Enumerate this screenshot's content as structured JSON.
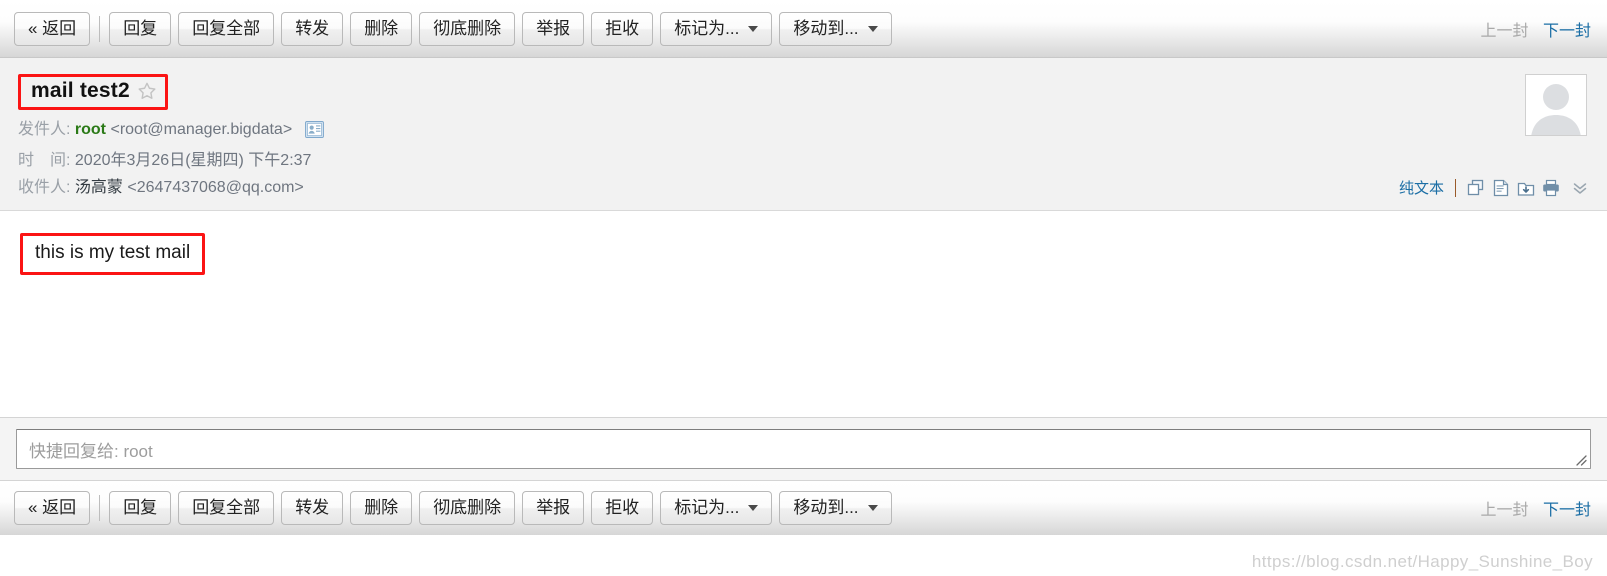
{
  "toolbar": {
    "buttons": [
      {
        "label": "« 返回",
        "type": "plain",
        "name": "back-button"
      },
      {
        "label": "回复",
        "type": "plain",
        "name": "reply-button"
      },
      {
        "label": "回复全部",
        "type": "plain",
        "name": "reply-all-button"
      },
      {
        "label": "转发",
        "type": "plain",
        "name": "forward-button"
      },
      {
        "label": "删除",
        "type": "plain",
        "name": "delete-button"
      },
      {
        "label": "彻底删除",
        "type": "plain",
        "name": "delete-permanently-button"
      },
      {
        "label": "举报",
        "type": "plain",
        "name": "report-button"
      },
      {
        "label": "拒收",
        "type": "plain",
        "name": "reject-button"
      },
      {
        "label": "标记为...",
        "type": "dropdown",
        "name": "mark-as-dropdown"
      },
      {
        "label": "移动到...",
        "type": "dropdown",
        "name": "move-to-dropdown"
      }
    ],
    "prev_label": "上一封",
    "next_label": "下一封",
    "prev_color": "#a9a9a9",
    "next_color": "#1b6ea5"
  },
  "mail": {
    "subject": "mail test2",
    "star_icon": "star-outline-icon",
    "sender_label": "发件人:",
    "sender_name": "root",
    "sender_address": "<root@manager.bigdata>",
    "sender_color": "#2b7a17",
    "contact_icon": "contact-card-icon",
    "time_label": "时　间:",
    "time_value": "2020年3月26日(星期四) 下午2:37",
    "to_label": "收件人:",
    "to_name": "汤高蒙",
    "to_address": "<2647437068@qq.com>",
    "avatar_icon": "default-user-avatar",
    "body_text": "this is my test mail"
  },
  "head_actions": {
    "plain_text_label": "纯文本",
    "icons": [
      {
        "name": "open-in-new-window-icon"
      },
      {
        "name": "view-source-icon"
      },
      {
        "name": "save-to-drive-icon"
      },
      {
        "name": "print-icon"
      }
    ],
    "chevron_icon": "chevron-double-down-icon"
  },
  "quick_reply": {
    "placeholder": "快捷回复给: root",
    "value": "",
    "resize_handle": "resize-grip-icon"
  },
  "watermark": "https://blog.csdn.net/Happy_Sunshine_Boy",
  "colors": {
    "annotation_red": "#fb1414",
    "link_blue": "#1b6ea5",
    "header_bg": "#f2f2f2"
  }
}
